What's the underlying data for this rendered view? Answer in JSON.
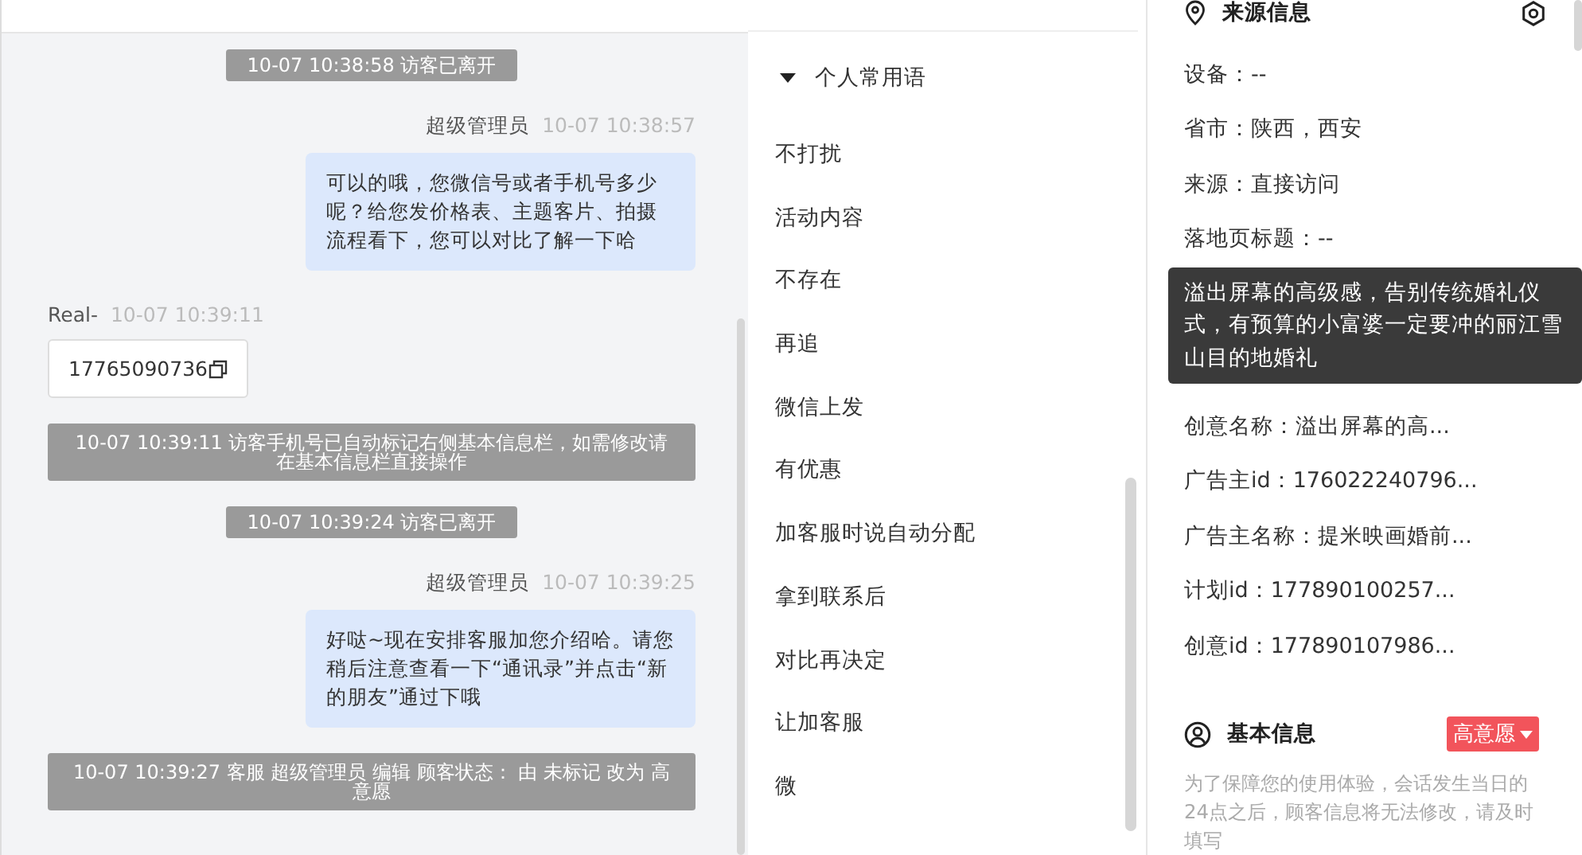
{
  "chat": {
    "messages": [
      {
        "kind": "system",
        "text": "10-07 10:38:58 访客已离开"
      },
      {
        "kind": "agent",
        "sender": "超级管理员",
        "time": "10-07 10:38:57",
        "text": "可以的哦，您微信号或者手机号多少呢？给您发价格表、主题客片、拍摄流程看下，您可以对比了解一下哈"
      },
      {
        "kind": "visitor",
        "sender": "Real-",
        "time": "10-07 10:39:11",
        "text": "17765090736"
      },
      {
        "kind": "system",
        "text": "10-07 10:39:11 访客手机号已自动标记右侧基本信息栏，如需修改请在基本信息栏直接操作"
      },
      {
        "kind": "system",
        "text": "10-07 10:39:24 访客已离开"
      },
      {
        "kind": "agent",
        "sender": "超级管理员",
        "time": "10-07 10:39:25",
        "text": "好哒~现在安排客服加您介绍哈。请您稍后注意查看一下“通讯录”并点击“新的朋友”通过下哦"
      },
      {
        "kind": "system",
        "text": "10-07 10:39:27 客服 超级管理员 编辑 顾客状态： 由 未标记 改为 高意愿"
      }
    ]
  },
  "phrases": {
    "group": {
      "label": "个人常用语",
      "expanded": true
    },
    "items": [
      "不打扰",
      "活动内容",
      "不存在",
      "再追",
      "微信上发",
      "有优惠",
      "加客服时说自动分配",
      "拿到联系后",
      "对比再决定",
      "让加客服",
      "微"
    ]
  },
  "source_info": {
    "title": "来源信息",
    "rows": [
      "设备：--",
      "省市：陕西，西安",
      "来源：直接访问",
      "落地页标题：--",
      "创意名称：溢出屏幕的高...",
      "广告主id：176022240796...",
      "广告主名称：提米映画婚前...",
      "计划id：177890100257...",
      "创意id：177890107986..."
    ],
    "tooltip": "溢出屏幕的高级感，告别传统婚礼仪式，有预算的小富婆一定要冲的丽江雪山目的地婚礼"
  },
  "basic_info": {
    "title": "基本信息",
    "status": "高意愿",
    "note": "为了保障您的使用体验，会话发生当日的24点之后，顾客信息将无法修改，请及时填写"
  }
}
